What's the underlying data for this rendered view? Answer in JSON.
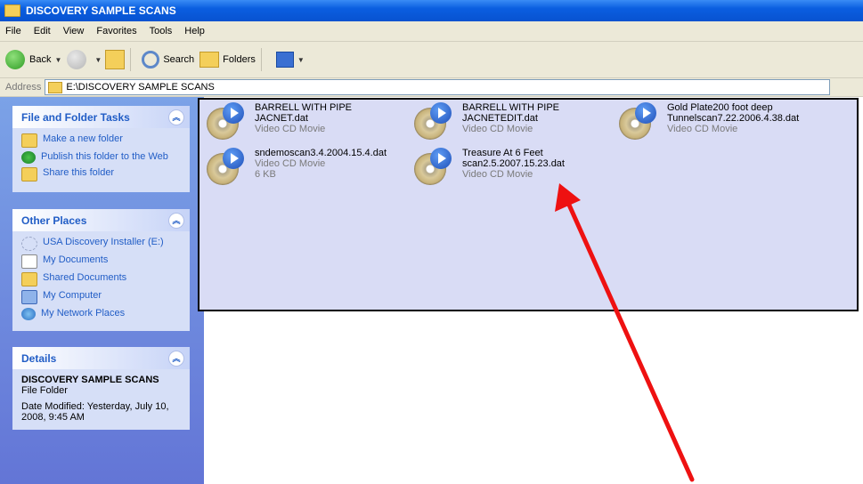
{
  "window": {
    "title": "DISCOVERY SAMPLE SCANS"
  },
  "menu": [
    "File",
    "Edit",
    "View",
    "Favorites",
    "Tools",
    "Help"
  ],
  "toolbar": {
    "back": "Back",
    "search": "Search",
    "folders": "Folders"
  },
  "address": {
    "label": "Address",
    "path": "E:\\DISCOVERY SAMPLE SCANS"
  },
  "left_panel": {
    "file_tasks": {
      "title": "File and Folder Tasks",
      "items": [
        "Make a new folder",
        "Publish this folder to the Web",
        "Share this folder"
      ]
    },
    "other_places": {
      "title": "Other Places",
      "items": [
        "USA Discovery Installer (E:)",
        "My Documents",
        "Shared Documents",
        "My Computer",
        "My Network Places"
      ]
    },
    "details": {
      "title": "Details",
      "name": "DISCOVERY SAMPLE SCANS",
      "type": "File Folder",
      "modified": "Date Modified: Yesterday, July 10, 2008, 9:45 AM"
    }
  },
  "files": [
    {
      "name_line1": "BARRELL WITH PIPE",
      "name_line2": "JACNET.dat",
      "type": "Video CD Movie",
      "size": ""
    },
    {
      "name_line1": "BARRELL WITH PIPE",
      "name_line2": "JACNETEDIT.dat",
      "type": "Video CD Movie",
      "size": ""
    },
    {
      "name_line1": "Gold Plate200 foot deep",
      "name_line2": "Tunnelscan7.22.2006.4.38.dat",
      "type": "Video CD Movie",
      "size": ""
    },
    {
      "name_line1": "sndemoscan3.4.2004.15.4.dat",
      "name_line2": "",
      "type": "Video CD Movie",
      "size": "6 KB"
    },
    {
      "name_line1": "Treasure At 6 Feet",
      "name_line2": "scan2.5.2007.15.23.dat",
      "type": "Video CD Movie",
      "size": ""
    }
  ],
  "colors": {
    "title_bar": "#0a5ee0",
    "left_panel": "#6f8ddc",
    "selection": "#d9dcf5",
    "annotation_arrow": "#ee1111"
  }
}
